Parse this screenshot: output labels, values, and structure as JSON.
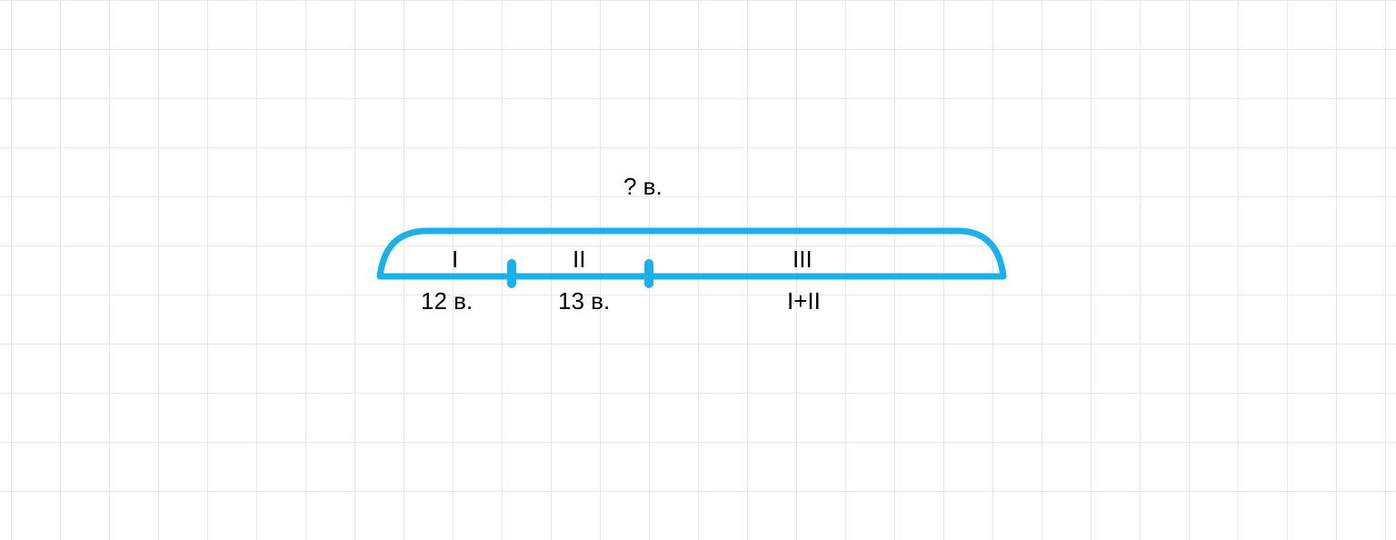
{
  "diagram": {
    "question_label": "? в.",
    "segments": {
      "seg1": {
        "roman": "I",
        "value": "12 в."
      },
      "seg2": {
        "roman": "II",
        "value": "13 в."
      },
      "seg3": {
        "roman": "III",
        "value": "I+II"
      }
    },
    "stroke_color": "#1ab1ea",
    "grid_color": "#e8e8e8"
  }
}
